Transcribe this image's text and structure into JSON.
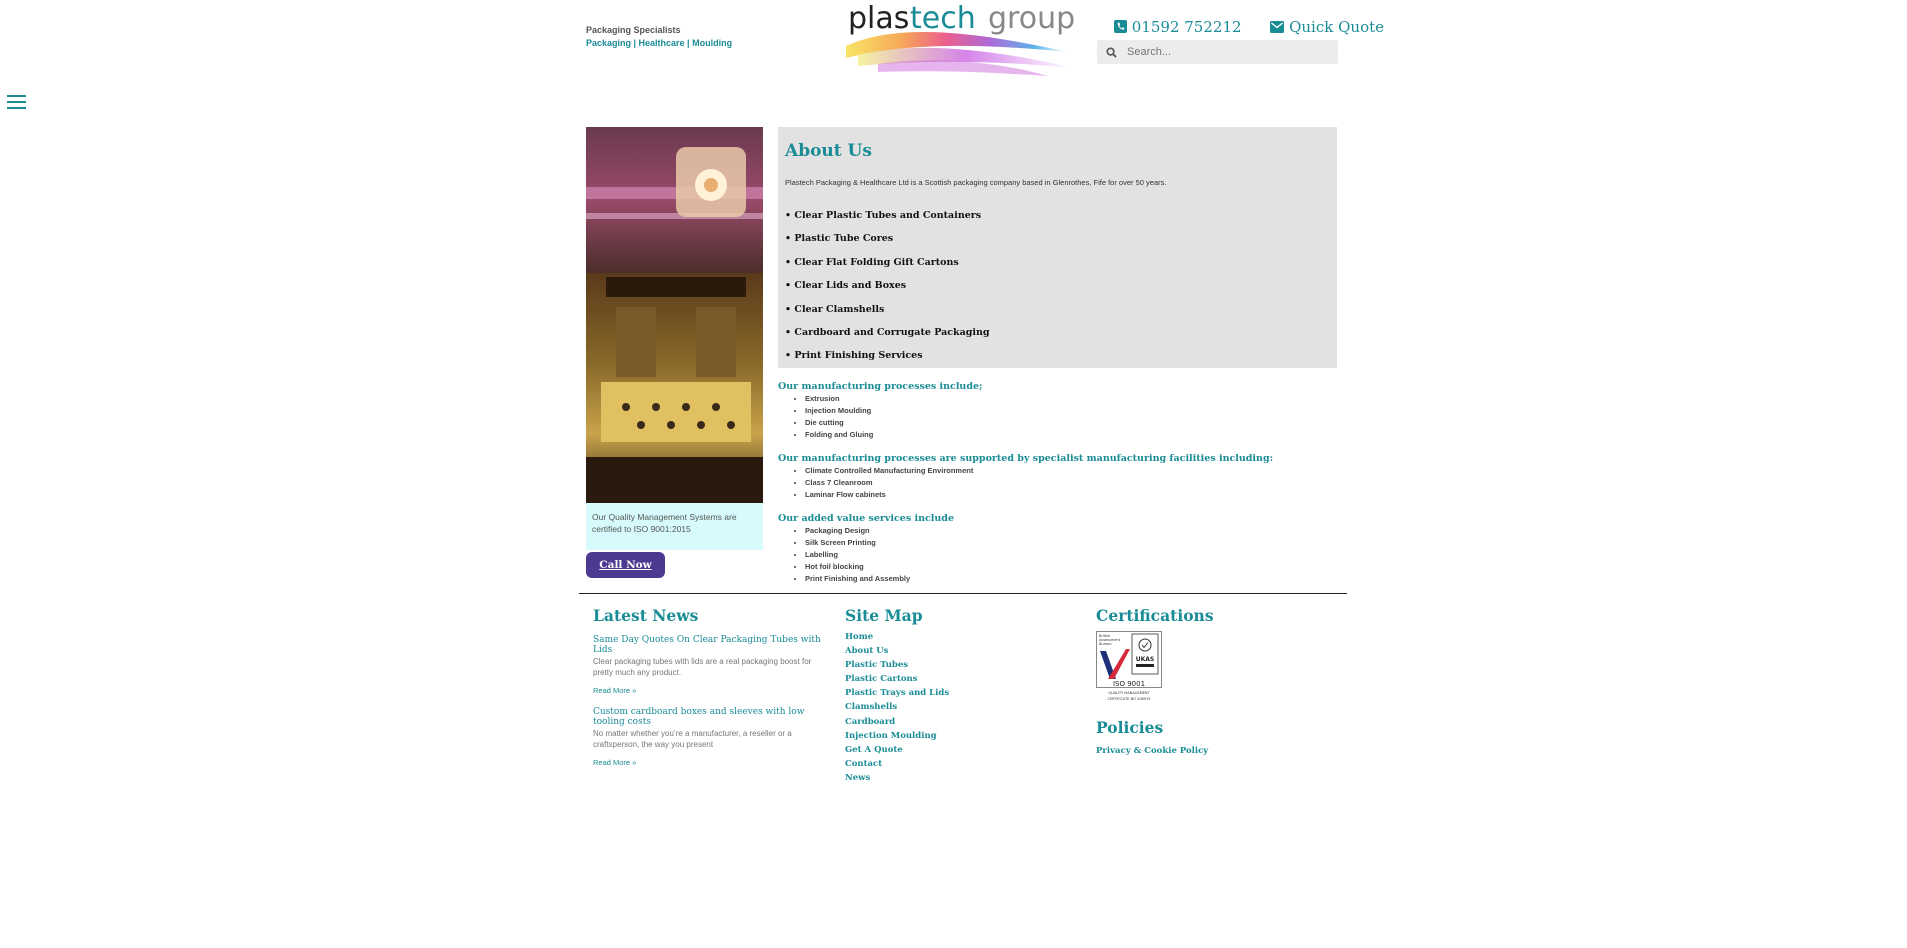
{
  "header": {
    "tagline_top": "Packaging Specialists",
    "tagline_bottom": "Packaging | Healthcare | Moulding",
    "logo_text_plas": "plas",
    "logo_text_tech": "tech",
    "logo_text_group": "group",
    "phone": "01592 752212",
    "quick_quote": "Quick Quote",
    "search_placeholder": "Search..."
  },
  "sidebar": {
    "iso_note": "Our Quality Management Systems are certified to ISO 9001:2015",
    "call_button": "Call Now"
  },
  "about": {
    "title": "About Us",
    "intro": "Plastech Packaging & Healthcare Ltd is a Scottish packaging company based in Glenrothes, Fife for over 50 years.",
    "products": [
      "• Clear Plastic Tubes and Containers",
      "• Plastic Tube Cores",
      "• Clear Flat Folding Gift Cartons",
      "• Clear Lids and Boxes",
      "• Clear Clamshells",
      "• Cardboard and Corrugate Packaging",
      "• Print Finishing Services"
    ]
  },
  "processes": {
    "heading1": "Our manufacturing processes include;",
    "list1": [
      "Extrusion",
      "Injection Moulding",
      "Die cutting",
      "Folding and Gluing"
    ],
    "heading2": "Our manufacturing processes are supported by specialist manufacturing facilities including:",
    "list2": [
      "Climate Controlled Manufacturing Environment",
      "Class 7 Cleanroom",
      "Laminar Flow cabinets"
    ],
    "heading3": "Our added value services include",
    "list3": [
      "Packaging Design",
      "Silk Screen Printing",
      "Labelling",
      "Hot foil blocking",
      "Print Finishing and Assembly"
    ]
  },
  "footer": {
    "news_title": "Latest News",
    "news": [
      {
        "title": "Same Day Quotes On Clear Packaging Tubes with Lids",
        "excerpt": "Clear packaging tubes with lids are a real packaging boost for pretty much any product.",
        "more": "Read More »"
      },
      {
        "title": "Custom cardboard boxes and sleeves with low tooling costs",
        "excerpt": "No matter whether you’re a manufacturer, a reseller or a craftsperson, the way you present",
        "more": "Read More »"
      }
    ],
    "sitemap_title": "Site Map",
    "sitemap": [
      "Home",
      "About Us",
      "Plastic Tubes",
      "Plastic Cartons",
      "Plastic Trays and Lids",
      "Clamshells",
      "Cardboard",
      "Injection Moulding",
      "Get A Quote",
      "Contact",
      "News"
    ],
    "certifications_title": "Certifications",
    "iso_badge": {
      "line1": "British",
      "line2": "Assessment",
      "line3": "Bureau",
      "ukas": "UKAS",
      "iso": "ISO 9001",
      "qm": "QUALITY MANAGEMENT",
      "cert": "CERTIFICATE NO 208919"
    },
    "policies_title": "Policies",
    "policy_link": "Privacy & Cookie Policy"
  },
  "colors": {
    "accent": "#1a8c96",
    "call_button": "#4b3a8f",
    "iso_note_bg": "#d7fbfc",
    "about_bg": "#e2e2e2"
  }
}
